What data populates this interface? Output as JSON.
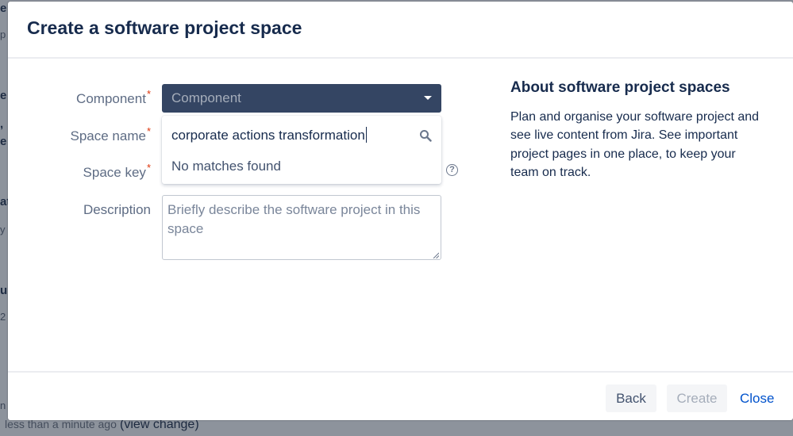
{
  "background": {
    "fragments": [
      "e",
      "p",
      "e",
      ",",
      "e",
      "at",
      "y",
      "u",
      "2",
      "n"
    ],
    "footer_time": "less than a minute ago",
    "footer_link": "(view change)"
  },
  "modal": {
    "title": "Create a software project space",
    "form": {
      "component_label": "Component",
      "component_placeholder": "Component",
      "space_name_label": "Space name",
      "space_key_label": "Space key",
      "description_label": "Description",
      "description_placeholder": "Briefly describe the software project in this space",
      "required_mark": "*"
    },
    "dropdown": {
      "search_value": "corporate actions transformation",
      "no_results": "No matches found"
    },
    "about": {
      "heading": "About software project spaces",
      "body": "Plan and organise your software project and see live content from Jira. See important project pages in one place, to keep your team on track."
    },
    "buttons": {
      "back": "Back",
      "create": "Create",
      "close": "Close"
    }
  },
  "icons": {
    "search": "search-icon",
    "help": "help-icon",
    "chevron": "chevron-down-icon"
  },
  "colors": {
    "select_bg": "#344563",
    "link": "#0052cc",
    "required": "#de350b",
    "title": "#172b4d"
  }
}
